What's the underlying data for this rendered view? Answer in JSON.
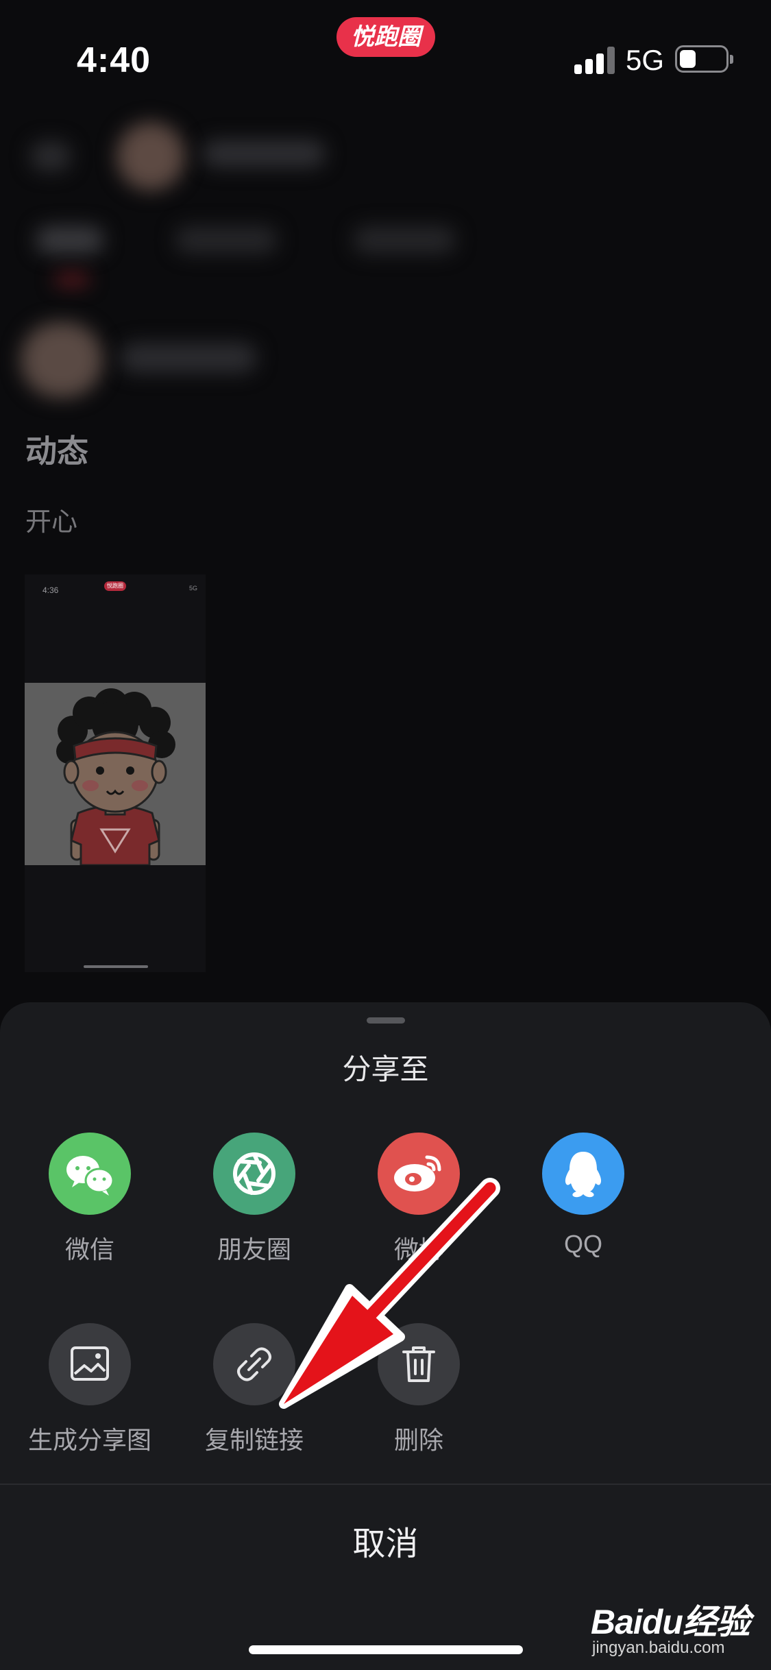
{
  "status_bar": {
    "time": "4:40",
    "app_badge": "悦跑圈",
    "network": "5G",
    "battery_level": 0.35
  },
  "post": {
    "title": "动态",
    "content": "开心",
    "thumbnail": {
      "time": "4:36",
      "app_badge": "悦跑圈",
      "network": "5G"
    }
  },
  "share_sheet": {
    "title": "分享至",
    "row1": [
      {
        "label": "微信",
        "icon": "wechat-icon",
        "color": "#5ac467"
      },
      {
        "label": "朋友圈",
        "icon": "moments-icon",
        "color": "#47a57a"
      },
      {
        "label": "微博",
        "icon": "weibo-icon",
        "color": "#e0524f"
      },
      {
        "label": "QQ",
        "icon": "qq-icon",
        "color": "#3b9cf0"
      }
    ],
    "row2": [
      {
        "label": "生成分享图",
        "icon": "image-icon",
        "color": "#3a3b3f"
      },
      {
        "label": "复制链接",
        "icon": "link-icon",
        "color": "#3a3b3f"
      },
      {
        "label": "删除",
        "icon": "trash-icon",
        "color": "#3a3b3f"
      }
    ],
    "cancel_label": "取消"
  },
  "annotation": {
    "arrow_color": "#e4131a"
  },
  "watermark": {
    "logo": "Baidu经验",
    "url": "jingyan.baidu.com"
  }
}
